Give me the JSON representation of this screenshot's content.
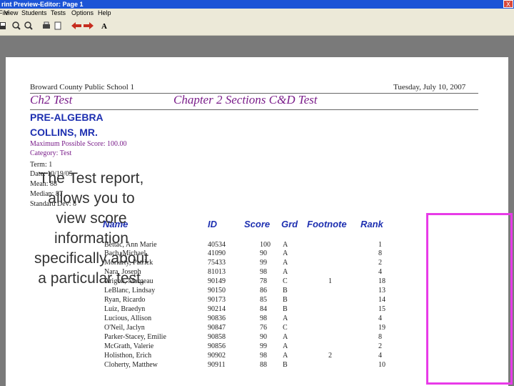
{
  "window": {
    "title": "rint Preview-Editor:  Page 1",
    "close": "X"
  },
  "menu": [
    "File",
    "View",
    "Students",
    "Tests",
    "Options",
    "Help"
  ],
  "toolbar": {
    "font_button": "A"
  },
  "report": {
    "school": "Broward County Public School 1",
    "date": "Tuesday, July 10, 2007",
    "test_short": "Ch2 Test",
    "test_title": "Chapter 2 Sections C&D Test",
    "course": "PRE-ALGEBRA",
    "teacher": "COLLINS, MR.",
    "max_score": "Maximum Possible Score:   100.00",
    "category": "Category:  Test",
    "info_lines": [
      "Term: 1",
      "Date: 10/19/05",
      "Mean: 88",
      "Median: 87",
      "Standard Dev: 8"
    ],
    "columns": {
      "name": "Name",
      "id": "ID",
      "score": "Score",
      "grade": "Grd",
      "footnote": "Footnote",
      "rank": "Rank"
    },
    "rows": [
      {
        "name": "Bettac, Ann Marie",
        "id": "40534",
        "score": "100",
        "grade": "A",
        "footnote": "",
        "rank": "1"
      },
      {
        "name": "Bach, Michael",
        "id": "41090",
        "score": "90",
        "grade": "A",
        "footnote": "",
        "rank": "8"
      },
      {
        "name": "Moriarty, Patrick",
        "id": "75433",
        "score": "99",
        "grade": "A",
        "footnote": "",
        "rank": "2"
      },
      {
        "name": "Nara, Joseph",
        "id": "81013",
        "score": "98",
        "grade": "A",
        "footnote": "",
        "rank": "4"
      },
      {
        "name": "Arigon, Margeau",
        "id": "90149",
        "score": "78",
        "grade": "C",
        "footnote": "1",
        "rank": "18"
      },
      {
        "name": "LeBlanc, Lindsay",
        "id": "90150",
        "score": "86",
        "grade": "B",
        "footnote": "",
        "rank": "13"
      },
      {
        "name": "Ryan, Ricardo",
        "id": "90173",
        "score": "85",
        "grade": "B",
        "footnote": "",
        "rank": "14"
      },
      {
        "name": "Luiz, Braedyn",
        "id": "90214",
        "score": "84",
        "grade": "B",
        "footnote": "",
        "rank": "15"
      },
      {
        "name": "Lucious, Allison",
        "id": "90836",
        "score": "98",
        "grade": "A",
        "footnote": "",
        "rank": "4"
      },
      {
        "name": "O'Neil, Jaclyn",
        "id": "90847",
        "score": "76",
        "grade": "C",
        "footnote": "",
        "rank": "19"
      },
      {
        "name": "Parker-Stacey, Emilie",
        "id": "90858",
        "score": "90",
        "grade": "A",
        "footnote": "",
        "rank": "8"
      },
      {
        "name": "McGrath, Valerie",
        "id": "90856",
        "score": "99",
        "grade": "A",
        "footnote": "",
        "rank": "2"
      },
      {
        "name": "Holisthon, Erich",
        "id": "90902",
        "score": "98",
        "grade": "A",
        "footnote": "2",
        "rank": "4"
      },
      {
        "name": "Cloherty, Matthew",
        "id": "90911",
        "score": "88",
        "grade": "B",
        "footnote": "",
        "rank": "10"
      }
    ]
  },
  "caption": "The Test report,\nallows you to\nview score\ninformation\nspecifically about\na particular test.",
  "colors": {
    "title_purple": "#7a1d8a",
    "heading_blue": "#1d2fb0",
    "highlight": "#e83be8"
  }
}
